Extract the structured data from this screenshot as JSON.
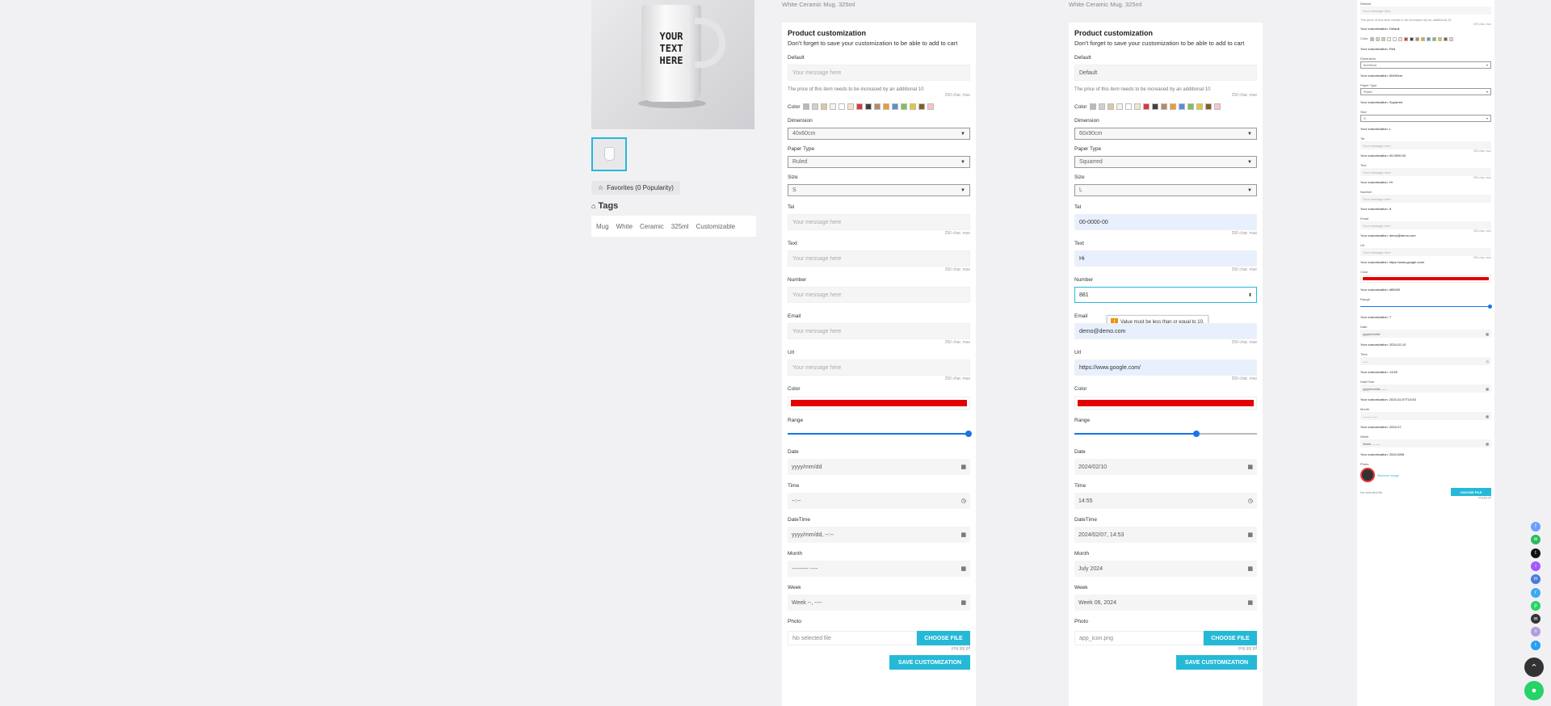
{
  "left": {
    "favorites_label": "Favorites (0 Popularity)",
    "tags_title": "Tags",
    "tags": [
      "Mug",
      "White",
      "Ceramic",
      "325ml",
      "Customizable"
    ],
    "mug_text": "YOUR TEXT HERE"
  },
  "colors": {
    "accent": "#25b9d7",
    "picked": "#e30000",
    "range": "#1a73e8",
    "swatches": [
      "#b9b9b9",
      "#cfcfcf",
      "#d9c9a6",
      "#f4f4e8",
      "#ffffff",
      "#f5e3c9",
      "#d9393f",
      "#404040",
      "#b58a6a",
      "#f09b2b",
      "#5a8fd6",
      "#7fbf5e",
      "#e4c833",
      "#8a5a2b",
      "#f7c6c8"
    ]
  },
  "panel1": {
    "breadcrumb": "White Ceramic Mug. 325ml",
    "title": "Product customization",
    "subtitle": "Don't forget to save your customization to be able to add to cart",
    "default_label": "Default",
    "default_placeholder": "Your message here",
    "price_note": "The price of this item needs to be increased by an additional 10",
    "price_hint": "250 char. max",
    "color_label": "Color",
    "dimension_label": "Dimension",
    "dimension_value": "40x60cm",
    "paper_label": "Paper Type",
    "paper_value": "Ruled",
    "size_label": "Size",
    "size_value": "S",
    "tel_label": "Tel",
    "tel_placeholder": "Your message here",
    "tel_hint": "250 char. max",
    "text_label": "Text",
    "text_placeholder": "Your message here",
    "text_hint": "250 char. max",
    "number_label": "Number",
    "number_placeholder": "Your message here",
    "email_label": "Email",
    "email_placeholder": "Your message here",
    "email_hint": "250 char. max",
    "url_label": "Url",
    "url_placeholder": "Your message here",
    "url_hint": "250 char. max",
    "color2_label": "Color",
    "range_label": "Range",
    "range_value": 1.0,
    "date_label": "Date",
    "date_value": "yyyy/mm/dd",
    "time_label": "Time",
    "time_value": "--:--",
    "datetime_label": "DateTime",
    "datetime_value": "yyyy/mm/dd, --:--",
    "month_label": "Month",
    "month_value": "--------- ----",
    "week_label": "Week",
    "week_value": "Week --, ----",
    "photo_label": "Photo",
    "file_value": "No selected file",
    "choose_file": "CHOOSE FILE",
    "file_hint": "png jpg gif",
    "save": "SAVE CUSTOMIZATION"
  },
  "panel2": {
    "breadcrumb": "White Ceramic Mug. 325ml",
    "title": "Product customization",
    "subtitle": "Don't forget to save your customization to be able to add to cart",
    "default_label": "Default",
    "default_value": "Default",
    "price_note": "The price of this item needs to be increased by an additional 10",
    "price_hint": "250 char. max",
    "color_label": "Color",
    "dimension_label": "Dimension",
    "dimension_value": "60x90cm",
    "paper_label": "Paper Type",
    "paper_value": "Squarred",
    "size_label": "Size",
    "size_value": "L",
    "tel_label": "Tel",
    "tel_value": "00-0000-00",
    "tel_hint": "250 char. max",
    "text_label": "Text",
    "text_value": "Hi",
    "text_hint": "250 char. max",
    "number_label": "Number",
    "number_value": "881",
    "tooltip": "Value must be less than or equal to 10.",
    "email_label": "Email",
    "email_value": "demo@demo.com",
    "email_hint": "250 char. max",
    "url_label": "Url",
    "url_value": "https://www.google.com/",
    "url_hint": "250 char. max",
    "color2_label": "Color",
    "range_label": "Range",
    "range_value": 0.67,
    "date_label": "Date",
    "date_value": "2024/02/10",
    "time_label": "Time",
    "time_value": "14:55",
    "datetime_label": "DateTime",
    "datetime_value": "2024/02/07, 14:53",
    "month_label": "Month",
    "month_value": "July 2024",
    "week_label": "Week",
    "week_value": "Week 06, 2024",
    "photo_label": "Photo",
    "file_value": "app_icon.png",
    "choose_file": "CHOOSE FILE",
    "file_hint": "png jpg gif",
    "save": "SAVE CUSTOMIZATION"
  },
  "panel3": {
    "default_label": "Default",
    "default_placeholder": "Your message here",
    "price_note": "The price of this item needs to be increased by an additional 10",
    "price_hint": "250 char. max",
    "cust_default": "Your customization: Default",
    "color_label": "Color",
    "cust_color": "Your customization: Red",
    "dimension_label": "Dimension",
    "dimension_value": "60x90cm",
    "cust_dimension": "Your customization: 60x90cm",
    "paper_label": "Paper Type",
    "paper_value": "Ruled",
    "cust_paper": "Your customization: Squarred",
    "size_label": "Size",
    "size_value": "S",
    "cust_size": "Your customization: L",
    "tel_label": "Tel",
    "tel_placeholder": "Your message here",
    "tel_hint": "250 char. max",
    "cust_tel": "Your customization: 00-0000-00",
    "text_label": "Text",
    "text_placeholder": "Your message here",
    "text_hint": "250 char. max",
    "cust_text": "Your customization: Hi",
    "number_label": "Number",
    "number_placeholder": "Your message here",
    "cust_number": "Your customization: 8",
    "email_label": "Email",
    "email_placeholder": "Your message here",
    "email_hint": "250 char. max",
    "cust_email": "Your customization: demo@demo.com",
    "url_label": "Url",
    "url_placeholder": "Your message here",
    "url_hint": "250 char. max",
    "cust_url": "Your customization: https://www.google.com/",
    "color2_label": "Color",
    "cust_color2": "Your customization: #ff0000",
    "range_label": "Range",
    "range_value": 1.0,
    "cust_range": "Your customization: 7",
    "date_label": "Date",
    "date_value": "yyyy/mm/dd",
    "cust_date": "Your customization: 2024-02-10",
    "time_label": "Time",
    "time_value": "--:--",
    "cust_time": "Your customization: 14:55",
    "datetime_label": "DateTime",
    "datetime_value": "yyyy/mm/dd, --:--",
    "cust_datetime": "Your customization: 2024-02-07T14:53",
    "month_label": "Month",
    "month_value": "--------- ----",
    "cust_month": "Your customization: 2024-07",
    "week_label": "Week",
    "week_value": "Week --, ----",
    "cust_week": "Your customization: 2024-W06",
    "photo_label": "Photo",
    "remove_image": "Remove image",
    "file_value": "No selected file",
    "choose_file": "CHOOSE FILE",
    "file_hint": "png jpg gif"
  },
  "social_colors": [
    "#6aa0ff",
    "#2dbb5d",
    "#111111",
    "#a259ff",
    "#4a7bd8",
    "#3fa9f5",
    "#25d366",
    "#333333",
    "#b39ddb",
    "#2a9df4"
  ]
}
